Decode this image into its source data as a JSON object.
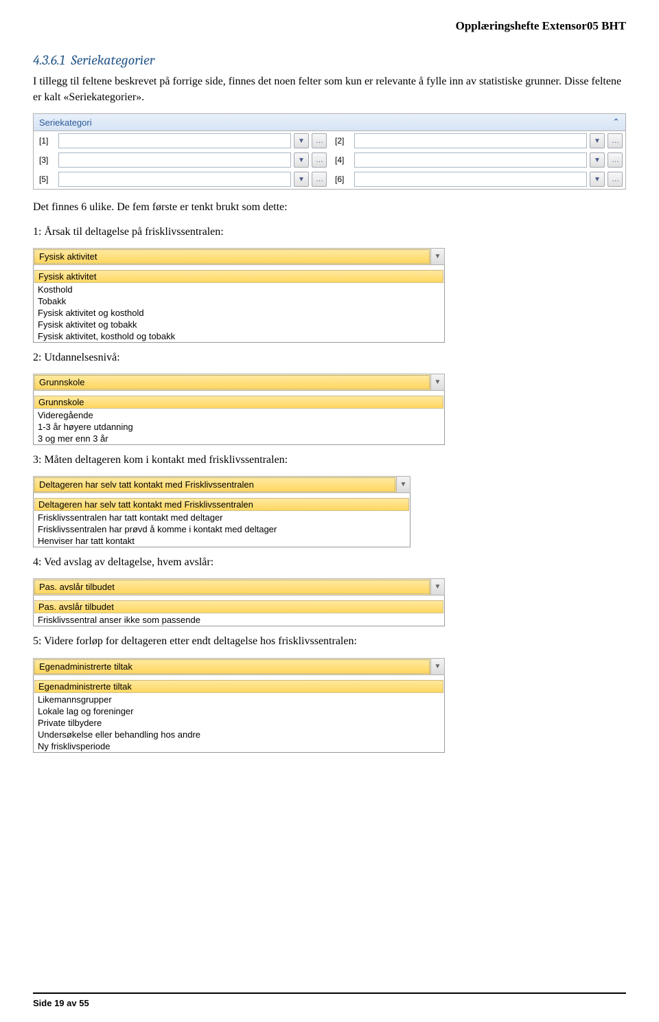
{
  "header": {
    "title": "Opplæringshefte Extensor05 BHT"
  },
  "section": {
    "number": "4.3.6.1",
    "title": "Seriekategorier"
  },
  "intro": {
    "p1": "I tillegg til feltene beskrevet på forrige side, finnes det noen felter som kun er relevante å fylle inn av statistiske grunner. Disse feltene er kalt «Seriekategorier».",
    "p2": "Det finnes 6 ulike. De fem første er tenkt brukt som dette:"
  },
  "panel": {
    "title": "Seriekategori",
    "fields": [
      "[1]",
      "[2]",
      "[3]",
      "[4]",
      "[5]",
      "[6]"
    ]
  },
  "labels": {
    "l1": "1: Årsak til deltagelse på frisklivssentralen:",
    "l2": "2: Utdannelsesnivå:",
    "l3": "3: Måten deltageren kom i kontakt med frisklivssentralen:",
    "l4": "4: Ved avslag av deltagelse, hvem avslår:",
    "l5": "5: Videre forløp for deltageren etter endt deltagelse hos frisklivssentralen:"
  },
  "combo1": {
    "selected": "Fysisk aktivitet",
    "options": [
      "Fysisk aktivitet",
      "Kosthold",
      "Tobakk",
      "Fysisk aktivitet og kosthold",
      "Fysisk aktivitet og tobakk",
      "Fysisk aktivitet, kosthold og tobakk"
    ]
  },
  "combo2": {
    "selected": "Grunnskole",
    "options": [
      "Grunnskole",
      "Videregående",
      "1-3 år høyere utdanning",
      "3 og mer enn 3 år"
    ]
  },
  "combo3": {
    "selected": "Deltageren har selv tatt kontakt med Frisklivssentralen",
    "options": [
      "Deltageren har selv tatt kontakt med Frisklivssentralen",
      "Frisklivssentralen har tatt kontakt med deltager",
      "Frisklivssentralen har prøvd å komme i kontakt med deltager",
      "Henviser har tatt kontakt"
    ]
  },
  "combo4": {
    "selected": "Pas. avslår tilbudet",
    "options": [
      "Pas. avslår tilbudet",
      "Frisklivssentral anser ikke som passende"
    ]
  },
  "combo5": {
    "selected": "Egenadministrerte tiltak",
    "options": [
      "Egenadministrerte tiltak",
      "Likemannsgrupper",
      "Lokale lag og foreninger",
      "Private tilbydere",
      "Undersøkelse eller behandling hos andre",
      "Ny frisklivsperiode"
    ]
  },
  "footer": {
    "text": "Side 19 av 55"
  }
}
